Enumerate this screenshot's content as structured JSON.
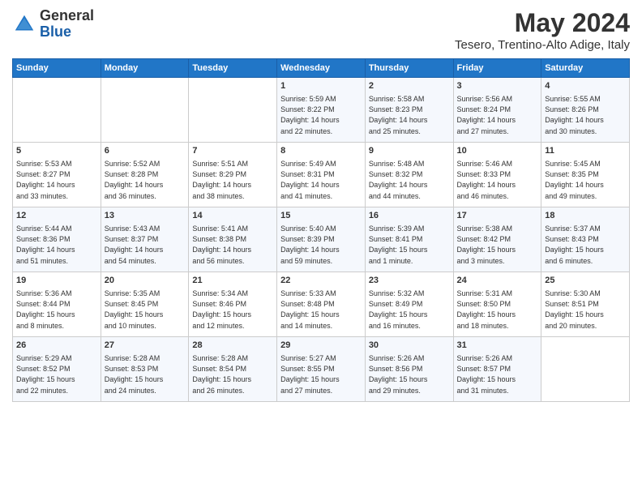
{
  "logo": {
    "line1": "General",
    "line2": "Blue"
  },
  "title": "May 2024",
  "subtitle": "Tesero, Trentino-Alto Adige, Italy",
  "weekdays": [
    "Sunday",
    "Monday",
    "Tuesday",
    "Wednesday",
    "Thursday",
    "Friday",
    "Saturday"
  ],
  "weeks": [
    [
      {
        "day": "",
        "info": ""
      },
      {
        "day": "",
        "info": ""
      },
      {
        "day": "",
        "info": ""
      },
      {
        "day": "1",
        "info": "Sunrise: 5:59 AM\nSunset: 8:22 PM\nDaylight: 14 hours\nand 22 minutes."
      },
      {
        "day": "2",
        "info": "Sunrise: 5:58 AM\nSunset: 8:23 PM\nDaylight: 14 hours\nand 25 minutes."
      },
      {
        "day": "3",
        "info": "Sunrise: 5:56 AM\nSunset: 8:24 PM\nDaylight: 14 hours\nand 27 minutes."
      },
      {
        "day": "4",
        "info": "Sunrise: 5:55 AM\nSunset: 8:26 PM\nDaylight: 14 hours\nand 30 minutes."
      }
    ],
    [
      {
        "day": "5",
        "info": "Sunrise: 5:53 AM\nSunset: 8:27 PM\nDaylight: 14 hours\nand 33 minutes."
      },
      {
        "day": "6",
        "info": "Sunrise: 5:52 AM\nSunset: 8:28 PM\nDaylight: 14 hours\nand 36 minutes."
      },
      {
        "day": "7",
        "info": "Sunrise: 5:51 AM\nSunset: 8:29 PM\nDaylight: 14 hours\nand 38 minutes."
      },
      {
        "day": "8",
        "info": "Sunrise: 5:49 AM\nSunset: 8:31 PM\nDaylight: 14 hours\nand 41 minutes."
      },
      {
        "day": "9",
        "info": "Sunrise: 5:48 AM\nSunset: 8:32 PM\nDaylight: 14 hours\nand 44 minutes."
      },
      {
        "day": "10",
        "info": "Sunrise: 5:46 AM\nSunset: 8:33 PM\nDaylight: 14 hours\nand 46 minutes."
      },
      {
        "day": "11",
        "info": "Sunrise: 5:45 AM\nSunset: 8:35 PM\nDaylight: 14 hours\nand 49 minutes."
      }
    ],
    [
      {
        "day": "12",
        "info": "Sunrise: 5:44 AM\nSunset: 8:36 PM\nDaylight: 14 hours\nand 51 minutes."
      },
      {
        "day": "13",
        "info": "Sunrise: 5:43 AM\nSunset: 8:37 PM\nDaylight: 14 hours\nand 54 minutes."
      },
      {
        "day": "14",
        "info": "Sunrise: 5:41 AM\nSunset: 8:38 PM\nDaylight: 14 hours\nand 56 minutes."
      },
      {
        "day": "15",
        "info": "Sunrise: 5:40 AM\nSunset: 8:39 PM\nDaylight: 14 hours\nand 59 minutes."
      },
      {
        "day": "16",
        "info": "Sunrise: 5:39 AM\nSunset: 8:41 PM\nDaylight: 15 hours\nand 1 minute."
      },
      {
        "day": "17",
        "info": "Sunrise: 5:38 AM\nSunset: 8:42 PM\nDaylight: 15 hours\nand 3 minutes."
      },
      {
        "day": "18",
        "info": "Sunrise: 5:37 AM\nSunset: 8:43 PM\nDaylight: 15 hours\nand 6 minutes."
      }
    ],
    [
      {
        "day": "19",
        "info": "Sunrise: 5:36 AM\nSunset: 8:44 PM\nDaylight: 15 hours\nand 8 minutes."
      },
      {
        "day": "20",
        "info": "Sunrise: 5:35 AM\nSunset: 8:45 PM\nDaylight: 15 hours\nand 10 minutes."
      },
      {
        "day": "21",
        "info": "Sunrise: 5:34 AM\nSunset: 8:46 PM\nDaylight: 15 hours\nand 12 minutes."
      },
      {
        "day": "22",
        "info": "Sunrise: 5:33 AM\nSunset: 8:48 PM\nDaylight: 15 hours\nand 14 minutes."
      },
      {
        "day": "23",
        "info": "Sunrise: 5:32 AM\nSunset: 8:49 PM\nDaylight: 15 hours\nand 16 minutes."
      },
      {
        "day": "24",
        "info": "Sunrise: 5:31 AM\nSunset: 8:50 PM\nDaylight: 15 hours\nand 18 minutes."
      },
      {
        "day": "25",
        "info": "Sunrise: 5:30 AM\nSunset: 8:51 PM\nDaylight: 15 hours\nand 20 minutes."
      }
    ],
    [
      {
        "day": "26",
        "info": "Sunrise: 5:29 AM\nSunset: 8:52 PM\nDaylight: 15 hours\nand 22 minutes."
      },
      {
        "day": "27",
        "info": "Sunrise: 5:28 AM\nSunset: 8:53 PM\nDaylight: 15 hours\nand 24 minutes."
      },
      {
        "day": "28",
        "info": "Sunrise: 5:28 AM\nSunset: 8:54 PM\nDaylight: 15 hours\nand 26 minutes."
      },
      {
        "day": "29",
        "info": "Sunrise: 5:27 AM\nSunset: 8:55 PM\nDaylight: 15 hours\nand 27 minutes."
      },
      {
        "day": "30",
        "info": "Sunrise: 5:26 AM\nSunset: 8:56 PM\nDaylight: 15 hours\nand 29 minutes."
      },
      {
        "day": "31",
        "info": "Sunrise: 5:26 AM\nSunset: 8:57 PM\nDaylight: 15 hours\nand 31 minutes."
      },
      {
        "day": "",
        "info": ""
      }
    ]
  ]
}
